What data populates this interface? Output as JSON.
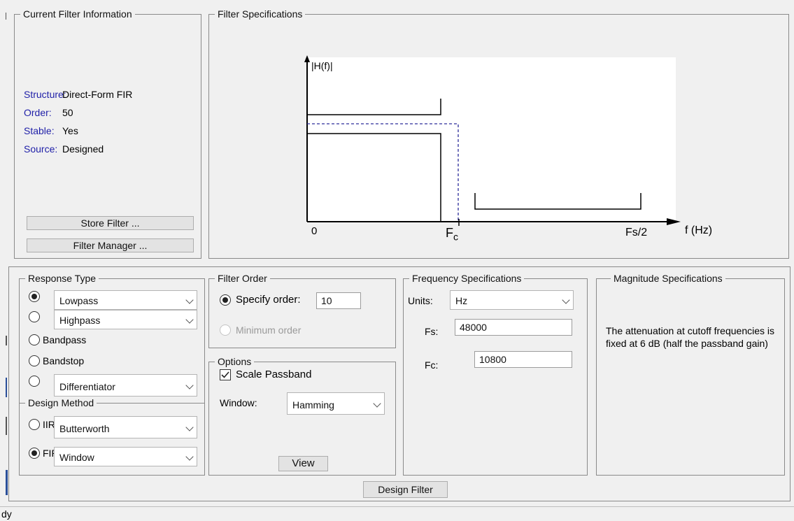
{
  "current_filter": {
    "title": "Current Filter Information",
    "rows": [
      {
        "key": "Structure:",
        "value": "Direct-Form FIR"
      },
      {
        "key": "Order:",
        "value": "50"
      },
      {
        "key": "Stable:",
        "value": "Yes"
      },
      {
        "key": "Source:",
        "value": "Designed"
      }
    ],
    "store_button": "Store Filter ...",
    "manager_button": "Filter Manager ..."
  },
  "filter_specs": {
    "title": "Filter Specifications",
    "y_label": "|H(f)|",
    "x_label": "f (Hz)",
    "tick_zero": "0",
    "tick_fc_main": "F",
    "tick_fc_sub": "c",
    "tick_fs2": "Fs/2"
  },
  "response_type": {
    "title": "Response Type",
    "lowpass": "Lowpass",
    "highpass": "Highpass",
    "bandpass": "Bandpass",
    "bandstop": "Bandstop",
    "differentiator": "Differentiator",
    "selected": "Lowpass"
  },
  "design_method": {
    "title": "Design Method",
    "iir_label": "IIR",
    "iir_type": "Butterworth",
    "fir_label": "FIR",
    "fir_type": "Window",
    "selected": "FIR"
  },
  "filter_order": {
    "title": "Filter Order",
    "specify_label": "Specify order:",
    "order_value": "10",
    "minimum_label": "Minimum order"
  },
  "options": {
    "title": "Options",
    "scale_passband_label": "Scale Passband",
    "scale_passband_checked": true,
    "window_label": "Window:",
    "window_value": "Hamming",
    "view_button": "View"
  },
  "frequency_specs": {
    "title": "Frequency Specifications",
    "units_label": "Units:",
    "units_value": "Hz",
    "fs_label": "Fs:",
    "fs_value": "48000",
    "fc_label": "Fc:",
    "fc_value": "10800"
  },
  "magnitude_specs": {
    "title": "Magnitude Specifications",
    "note": "The attenuation at cutoff frequencies is fixed at 6 dB (half the passband gain)"
  },
  "design_button": "Design Filter",
  "status_text": "dy"
}
